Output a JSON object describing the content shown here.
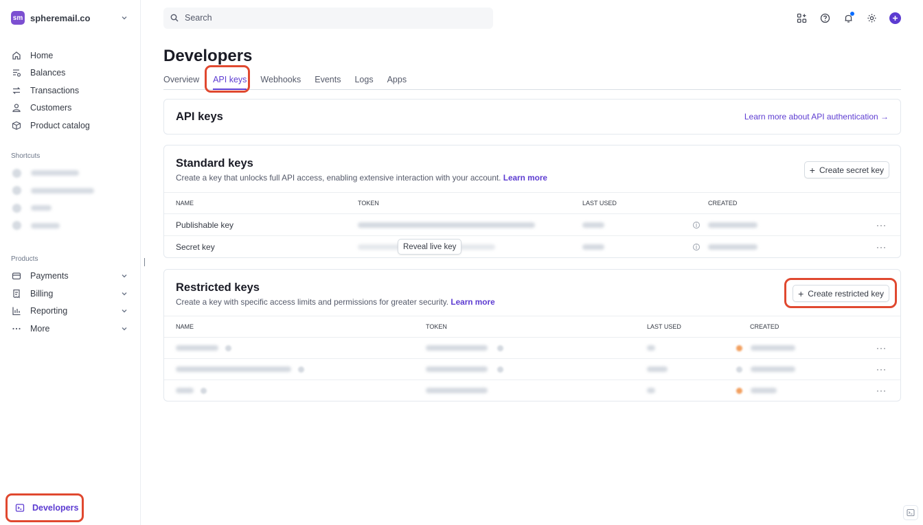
{
  "sidebar": {
    "account_name": "spheremail.co",
    "account_logo_text": "sm",
    "nav": [
      {
        "label": "Home",
        "icon": "home-icon"
      },
      {
        "label": "Balances",
        "icon": "balances-icon"
      },
      {
        "label": "Transactions",
        "icon": "transactions-icon"
      },
      {
        "label": "Customers",
        "icon": "customers-icon"
      },
      {
        "label": "Product catalog",
        "icon": "product-catalog-icon"
      }
    ],
    "shortcuts_title": "Shortcuts",
    "products_title": "Products",
    "products": [
      {
        "label": "Payments",
        "icon": "payments-icon"
      },
      {
        "label": "Billing",
        "icon": "billing-icon"
      },
      {
        "label": "Reporting",
        "icon": "reporting-icon"
      },
      {
        "label": "More",
        "icon": "more-icon"
      }
    ],
    "developers_label": "Developers"
  },
  "topbar": {
    "search_placeholder": "Search"
  },
  "page": {
    "title": "Developers",
    "tabs": [
      "Overview",
      "API keys",
      "Webhooks",
      "Events",
      "Logs",
      "Apps"
    ],
    "active_tab": "API keys"
  },
  "api_card": {
    "title": "API keys",
    "learn_more": "Learn more about API authentication →"
  },
  "standard": {
    "title": "Standard keys",
    "desc": "Create a key that unlocks full API access, enabling extensive interaction with your account.",
    "learn_more": "Learn more",
    "button": "Create secret key",
    "columns": [
      "NAME",
      "TOKEN",
      "LAST USED",
      "CREATED"
    ],
    "rows": [
      {
        "name": "Publishable key"
      },
      {
        "name": "Secret key",
        "reveal": "Reveal live key"
      }
    ]
  },
  "restricted": {
    "title": "Restricted keys",
    "desc": "Create a key with specific access limits and permissions for greater security.",
    "learn_more": "Learn more",
    "button": "Create restricted key",
    "columns": [
      "NAME",
      "TOKEN",
      "LAST USED",
      "CREATED"
    ]
  },
  "colors": {
    "accent": "#5c3bd1",
    "highlight": "#e0482f"
  }
}
